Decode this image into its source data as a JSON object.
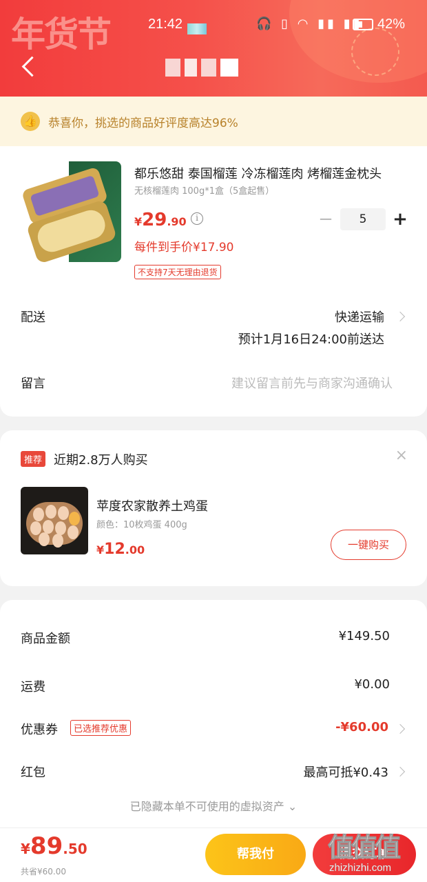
{
  "status_bar": {
    "time": "21:42",
    "battery_pct": "42%",
    "icons": "🎧 ▯ ◠ ▮▮ ▮▮"
  },
  "header": {
    "decor_text": "年货节"
  },
  "notice": {
    "icon": "thumbs-up-icon",
    "text": "恭喜你，挑选的商品好评度高达96%"
  },
  "product": {
    "title": "都乐悠甜 泰国榴莲 冷冻榴莲肉 烤榴莲金枕头",
    "spec": "无核榴莲肉 100g*1盒（5盒起售）",
    "price_currency": "¥",
    "price_int": "29",
    "price_dec": ".90",
    "info_icon": "i",
    "qty_minus": "−",
    "quantity": "5",
    "qty_plus": "+",
    "unit_price": "每件到手价¥17.90",
    "no_return": "不支持7天无理由退货"
  },
  "delivery": {
    "label": "配送",
    "method": "快递运输",
    "eta": "预计1月16日24:00前送达"
  },
  "memo": {
    "label": "留言",
    "placeholder": "建议留言前先与商家沟通确认"
  },
  "recommend": {
    "tag": "推荐",
    "title": "近期2.8万人购买",
    "close": "×",
    "name": "苹度农家散养土鸡蛋",
    "spec": "颜色：10枚鸡蛋 400g",
    "price_currency": "¥",
    "price_int": "12",
    "price_dec": ".00",
    "buy_label": "一键购买"
  },
  "summary": {
    "goods_label": "商品金额",
    "goods_value": "¥149.50",
    "shipping_label": "运费",
    "shipping_value": "¥0.00",
    "coupon_label": "优惠券",
    "coupon_tag": "已选推荐优惠",
    "coupon_value": "-¥60.00",
    "redpacket_label": "红包",
    "redpacket_value": "最高可抵¥0.43",
    "hidden_note": "已隐藏本单不可使用的虚拟资产 ⌄"
  },
  "bottom": {
    "total_currency": "¥",
    "total_int": "89",
    "total_dec": ".50",
    "saved": "共省¥60.00",
    "help_pay": "帮我付",
    "submit": "提交订单"
  },
  "watermark": {
    "logo": "值值值",
    "site": "zhizhizhi.com"
  },
  "colors": {
    "accent_red": "#e43a2c",
    "header_red": "#f23c3c",
    "help_pay_yellow": "#fcc419"
  }
}
